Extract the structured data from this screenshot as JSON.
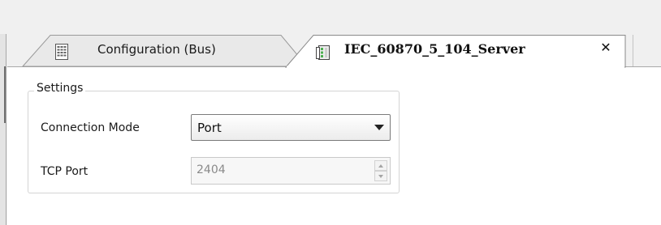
{
  "tabs": [
    {
      "label": "Configuration (Bus)",
      "icon": "configuration-page-icon",
      "active": false
    },
    {
      "label": "IEC_60870_5_104_Server",
      "icon": "server-device-icon",
      "active": true,
      "close_glyph": "✕"
    }
  ],
  "settings": {
    "group_title": "Settings",
    "connection_mode": {
      "label": "Connection Mode",
      "value": "Port"
    },
    "tcp_port": {
      "label": "TCP Port",
      "value": "2404",
      "disabled": true
    }
  },
  "colors": {
    "workspace_bg": "#f0f0f0",
    "panel_bg": "#ffffff",
    "server_icon_green": "#4caf50"
  }
}
